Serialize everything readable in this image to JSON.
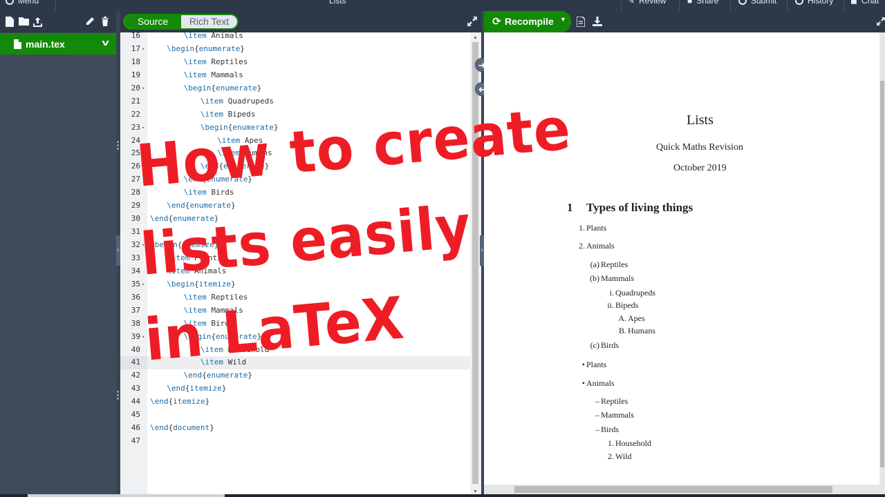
{
  "topbar": {
    "menu_label": "Menu",
    "project_title": "Lists",
    "review_label": "Review",
    "share_label": "Share",
    "submit_label": "Submit",
    "history_label": "History",
    "chat_label": "Chat"
  },
  "file_tree": {
    "toolbar_icons": [
      "new-file-icon",
      "new-folder-icon",
      "upload-icon",
      "rename-icon",
      "delete-icon"
    ],
    "files": [
      {
        "name": "main.tex",
        "selected": true
      }
    ]
  },
  "editor": {
    "mode_source": "Source",
    "mode_rich": "Rich Text",
    "active_line": 41,
    "lines": [
      {
        "n": "16",
        "fold": "",
        "indent": 2,
        "parts": [
          [
            "k",
            "\\item"
          ],
          [
            "p",
            " Animals"
          ]
        ]
      },
      {
        "n": "17",
        "fold": "▾",
        "indent": 1,
        "parts": [
          [
            "k",
            "\\begin"
          ],
          [
            "p",
            "{"
          ],
          [
            "k",
            "enumerate"
          ],
          [
            "p",
            "}"
          ]
        ]
      },
      {
        "n": "18",
        "fold": "",
        "indent": 2,
        "parts": [
          [
            "k",
            "\\item"
          ],
          [
            "p",
            " Reptiles"
          ]
        ]
      },
      {
        "n": "19",
        "fold": "",
        "indent": 2,
        "parts": [
          [
            "k",
            "\\item"
          ],
          [
            "p",
            " Mammals"
          ]
        ]
      },
      {
        "n": "20",
        "fold": "▾",
        "indent": 2,
        "parts": [
          [
            "k",
            "\\begin"
          ],
          [
            "p",
            "{"
          ],
          [
            "k",
            "enumerate"
          ],
          [
            "p",
            "}"
          ]
        ]
      },
      {
        "n": "21",
        "fold": "",
        "indent": 3,
        "parts": [
          [
            "k",
            "\\item"
          ],
          [
            "p",
            " Quadrupeds"
          ]
        ]
      },
      {
        "n": "22",
        "fold": "",
        "indent": 3,
        "parts": [
          [
            "k",
            "\\item"
          ],
          [
            "p",
            " Bipeds"
          ]
        ]
      },
      {
        "n": "23",
        "fold": "▾",
        "indent": 3,
        "parts": [
          [
            "k",
            "\\begin"
          ],
          [
            "p",
            "{"
          ],
          [
            "k",
            "enumerate"
          ],
          [
            "p",
            "}"
          ]
        ]
      },
      {
        "n": "24",
        "fold": "",
        "indent": 4,
        "parts": [
          [
            "k",
            "\\item"
          ],
          [
            "p",
            " Apes"
          ]
        ]
      },
      {
        "n": "25",
        "fold": "",
        "indent": 4,
        "parts": [
          [
            "k",
            "\\item"
          ],
          [
            "p",
            " Humans"
          ]
        ]
      },
      {
        "n": "26",
        "fold": "",
        "indent": 3,
        "parts": [
          [
            "k",
            "\\end"
          ],
          [
            "p",
            "{"
          ],
          [
            "k",
            "enumerate"
          ],
          [
            "p",
            "}"
          ]
        ]
      },
      {
        "n": "27",
        "fold": "",
        "indent": 2,
        "parts": [
          [
            "k",
            "\\end"
          ],
          [
            "p",
            "{"
          ],
          [
            "k",
            "enumerate"
          ],
          [
            "p",
            "}"
          ]
        ]
      },
      {
        "n": "28",
        "fold": "",
        "indent": 2,
        "parts": [
          [
            "k",
            "\\item"
          ],
          [
            "p",
            " Birds"
          ]
        ]
      },
      {
        "n": "29",
        "fold": "",
        "indent": 1,
        "parts": [
          [
            "k",
            "\\end"
          ],
          [
            "p",
            "{"
          ],
          [
            "k",
            "enumerate"
          ],
          [
            "p",
            "}"
          ]
        ]
      },
      {
        "n": "30",
        "fold": "",
        "indent": 0,
        "parts": [
          [
            "k",
            "\\end"
          ],
          [
            "p",
            "{"
          ],
          [
            "k",
            "enumerate"
          ],
          [
            "p",
            "}"
          ]
        ]
      },
      {
        "n": "31",
        "fold": "",
        "indent": 0,
        "parts": []
      },
      {
        "n": "32",
        "fold": "▾",
        "indent": 0,
        "parts": [
          [
            "k",
            "\\begin"
          ],
          [
            "p",
            "{"
          ],
          [
            "k",
            "itemize"
          ],
          [
            "p",
            "}"
          ]
        ]
      },
      {
        "n": "33",
        "fold": "",
        "indent": 1,
        "parts": [
          [
            "k",
            "\\item"
          ],
          [
            "p",
            " Plants"
          ]
        ]
      },
      {
        "n": "34",
        "fold": "",
        "indent": 1,
        "parts": [
          [
            "k",
            "\\item"
          ],
          [
            "p",
            " Animals"
          ]
        ]
      },
      {
        "n": "35",
        "fold": "▾",
        "indent": 1,
        "parts": [
          [
            "k",
            "\\begin"
          ],
          [
            "p",
            "{"
          ],
          [
            "k",
            "itemize"
          ],
          [
            "p",
            "}"
          ]
        ]
      },
      {
        "n": "36",
        "fold": "",
        "indent": 2,
        "parts": [
          [
            "k",
            "\\item"
          ],
          [
            "p",
            " Reptiles"
          ]
        ]
      },
      {
        "n": "37",
        "fold": "",
        "indent": 2,
        "parts": [
          [
            "k",
            "\\item"
          ],
          [
            "p",
            " Mammals"
          ]
        ]
      },
      {
        "n": "38",
        "fold": "",
        "indent": 2,
        "parts": [
          [
            "k",
            "\\item"
          ],
          [
            "p",
            " Birds"
          ]
        ]
      },
      {
        "n": "39",
        "fold": "▾",
        "indent": 2,
        "parts": [
          [
            "k",
            "\\begin"
          ],
          [
            "p",
            "{"
          ],
          [
            "k",
            "enumerate"
          ],
          [
            "p",
            "}"
          ]
        ]
      },
      {
        "n": "40",
        "fold": "",
        "indent": 3,
        "parts": [
          [
            "k",
            "\\item"
          ],
          [
            "p",
            " Household"
          ]
        ]
      },
      {
        "n": "41",
        "fold": "",
        "indent": 3,
        "parts": [
          [
            "k",
            "\\item"
          ],
          [
            "p",
            " Wild"
          ]
        ]
      },
      {
        "n": "42",
        "fold": "",
        "indent": 2,
        "parts": [
          [
            "k",
            "\\end"
          ],
          [
            "p",
            "{"
          ],
          [
            "k",
            "enumerate"
          ],
          [
            "p",
            "}"
          ]
        ]
      },
      {
        "n": "43",
        "fold": "",
        "indent": 1,
        "parts": [
          [
            "k",
            "\\end"
          ],
          [
            "p",
            "{"
          ],
          [
            "k",
            "itemize"
          ],
          [
            "p",
            "}"
          ]
        ]
      },
      {
        "n": "44",
        "fold": "",
        "indent": 0,
        "parts": [
          [
            "k",
            "\\end"
          ],
          [
            "p",
            "{"
          ],
          [
            "k",
            "itemize"
          ],
          [
            "p",
            "}"
          ]
        ]
      },
      {
        "n": "45",
        "fold": "",
        "indent": 0,
        "parts": []
      },
      {
        "n": "46",
        "fold": "",
        "indent": 0,
        "parts": [
          [
            "k",
            "\\end"
          ],
          [
            "p",
            "{"
          ],
          [
            "k",
            "document"
          ],
          [
            "p",
            "}"
          ]
        ]
      },
      {
        "n": "47",
        "fold": "",
        "indent": 0,
        "parts": []
      }
    ]
  },
  "pdf_toolbar": {
    "recompile_label": "Recompile",
    "icons": [
      "document-icon",
      "download-icon"
    ]
  },
  "pdf": {
    "title": "Lists",
    "author": "Quick Maths Revision",
    "date": "October 2019",
    "section_number": "1",
    "section_title": "Types of living things",
    "items": [
      {
        "marker": "1.",
        "text": "Plants",
        "level": 1
      },
      {
        "marker": "2.",
        "text": "Animals",
        "level": 1
      },
      {
        "marker": "(a)",
        "text": "Reptiles",
        "level": 2
      },
      {
        "marker": "(b)",
        "text": "Mammals",
        "level": 2
      },
      {
        "marker": "i.",
        "text": "Quadrupeds",
        "level": 3
      },
      {
        "marker": "ii.",
        "text": "Bipeds",
        "level": 3
      },
      {
        "marker": "A.",
        "text": "Apes",
        "level": 4
      },
      {
        "marker": "B.",
        "text": "Humans",
        "level": 4
      },
      {
        "marker": "(c)",
        "text": "Birds",
        "level": 2
      },
      {
        "marker": "•",
        "text": "Plants",
        "level": 1
      },
      {
        "marker": "•",
        "text": "Animals",
        "level": 1
      },
      {
        "marker": "–",
        "text": "Reptiles",
        "level": 2
      },
      {
        "marker": "–",
        "text": "Mammals",
        "level": 2
      },
      {
        "marker": "–",
        "text": "Birds",
        "level": 2
      },
      {
        "marker": "1.",
        "text": "Household",
        "level": 3
      },
      {
        "marker": "2.",
        "text": "Wild",
        "level": 3
      }
    ]
  },
  "overlay": {
    "line1": "How to create",
    "line2": "lists easily",
    "line3": "in LaTeX",
    "color": "#ee1d25"
  }
}
